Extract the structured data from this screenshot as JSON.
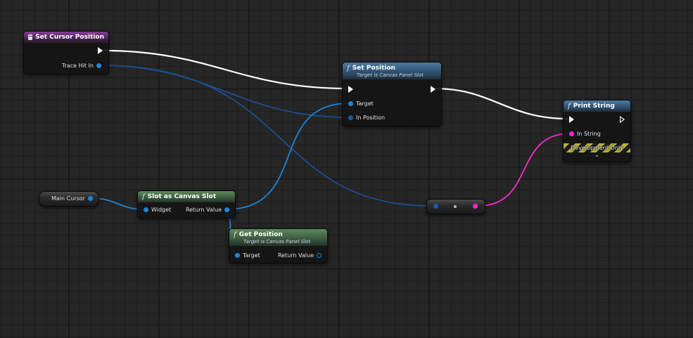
{
  "nodes": {
    "set_cursor_position": {
      "title": "Set Cursor Position",
      "pins": {
        "trace_hit_in": "Trace Hit In"
      }
    },
    "set_position": {
      "title": "Set Position",
      "subtitle": "Target is Canvas Panel Slot",
      "pins": {
        "target": "Target",
        "in_position": "In Position"
      }
    },
    "print_string": {
      "title": "Print String",
      "pins": {
        "in_string": "In String"
      },
      "development_only": "Development Only",
      "expand_glyph": "⌄"
    },
    "main_cursor": {
      "label": "Main Cursor"
    },
    "slot_as_canvas_slot": {
      "title": "Slot as Canvas Slot",
      "pins": {
        "widget": "Widget",
        "return_value": "Return Value"
      }
    },
    "get_position": {
      "title": "Get Position",
      "subtitle": "Target is Canvas Panel Slot",
      "pins": {
        "target": "Target",
        "return_value": "Return Value"
      }
    }
  },
  "function_glyph": "f",
  "colors": {
    "exec_wire": "#ffffff",
    "object_wire": "#1e86d8",
    "vector2d_wire": "#1d4f8e",
    "string_wire": "#ff2ad0",
    "event_header": "#8a3c9c",
    "function_header": "#4b7ba6",
    "pure_header": "#5f8a5c"
  },
  "icons": {
    "event": "event-node-icon",
    "function": "function-icon",
    "exec": "exec-arrow-icon"
  }
}
